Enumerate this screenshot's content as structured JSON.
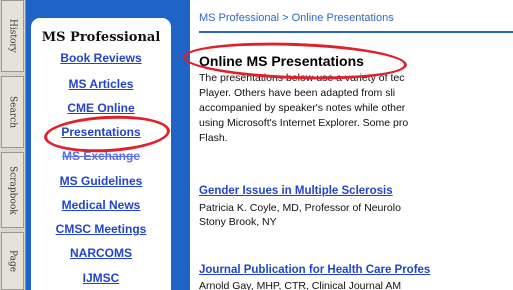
{
  "side_tabs": [
    "History",
    "Search",
    "Scrapbook",
    "Page"
  ],
  "nav": {
    "heading": "MS Professional",
    "items": [
      {
        "label": "Book Reviews"
      },
      {
        "label": "MS Articles"
      },
      {
        "label": "CME Online"
      },
      {
        "label": "Presentations",
        "annotated": true
      },
      {
        "label": "MS Exchange",
        "partially_hidden": true
      },
      {
        "label": "MS Guidelines"
      },
      {
        "label": "Medical News"
      },
      {
        "label": "CMSC Meetings"
      },
      {
        "label": "NARCOMS"
      },
      {
        "label": "IJMSC"
      }
    ]
  },
  "main": {
    "breadcrumb": "MS Professional > Online Presentations",
    "title": "Online MS Presentations",
    "intro_lines": [
      "The presentations below use a variety of tec",
      "Player. Others have been adapted from sli",
      "accompanied by speaker's notes while other",
      "using Microsoft's Internet Explorer. Some pro",
      "Flash."
    ],
    "articles": [
      {
        "title": "Gender Issues in Multiple Sclerosis",
        "desc_lines": [
          "Patricia K. Coyle, MD, Professor of Neurolo",
          "Stony Brook, NY"
        ]
      },
      {
        "title": "Journal Publication for Health Care Profes",
        "desc_lines": [
          "Arnold Gay, MHP, CTR, Clinical Journal AM"
        ]
      }
    ]
  },
  "annotations": {
    "color": "#e0202a",
    "circled": [
      "page-title",
      "Presentations"
    ]
  },
  "colors": {
    "frame_blue": "#1f63c6",
    "link_blue": "#2244cc",
    "breadcrumb_blue": "#3366cc"
  }
}
